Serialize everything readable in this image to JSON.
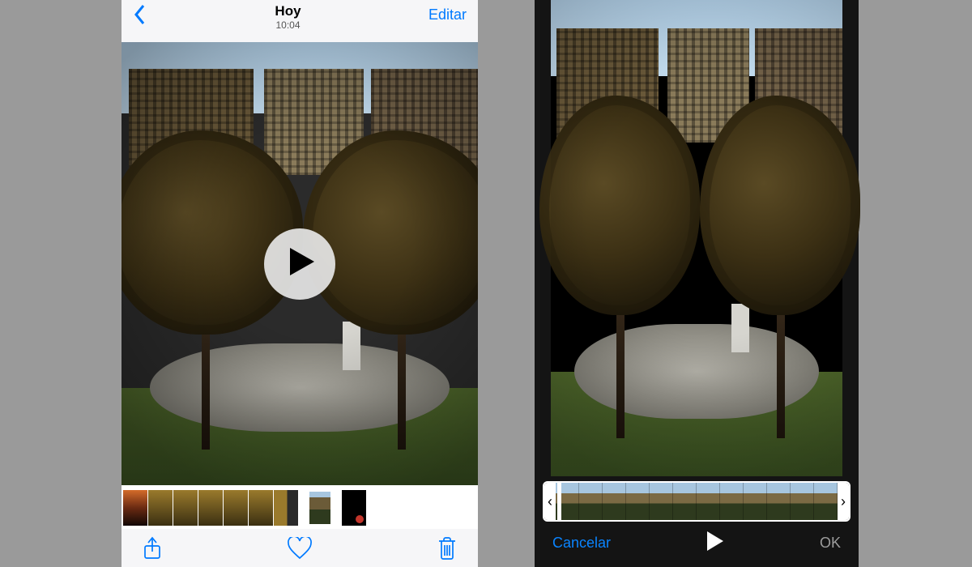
{
  "viewer": {
    "title": "Hoy",
    "timestamp": "10:04",
    "edit_label": "Editar",
    "play_icon": "play-icon",
    "toolbar": {
      "share_icon": "share-icon",
      "favorite_icon": "heart-icon",
      "delete_icon": "trash-icon"
    },
    "thumbnails": [
      {
        "kind": "sunset"
      },
      {
        "kind": "leaf"
      },
      {
        "kind": "leaf"
      },
      {
        "kind": "leaf"
      },
      {
        "kind": "leaf"
      },
      {
        "kind": "leaf"
      },
      {
        "kind": "mixed"
      },
      {
        "kind": "gap"
      },
      {
        "kind": "city",
        "selected": true
      },
      {
        "kind": "gap"
      },
      {
        "kind": "block"
      }
    ]
  },
  "editor": {
    "cancel_label": "Cancelar",
    "ok_label": "OK",
    "play_icon": "play-icon",
    "timeline_frame_count": 12,
    "left_trim_icon": "left-handle-icon",
    "right_trim_icon": "right-handle-icon"
  }
}
